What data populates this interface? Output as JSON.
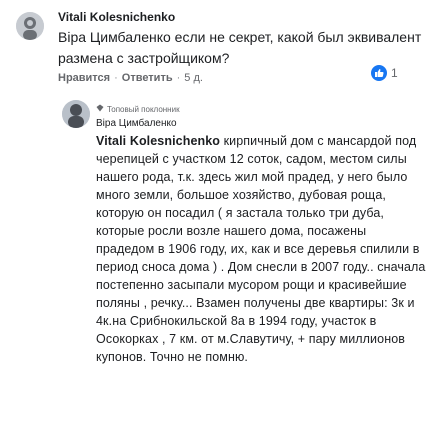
{
  "comment": {
    "author": "Vitali Kolesnichenko",
    "text": "Віра Цимбаленко если не секрет, какой был эквивалент размена с застройщиком?",
    "actions": {
      "like_label": "Нравится",
      "reply_label": "Ответить",
      "time": "5 д."
    },
    "reaction_count": "1"
  },
  "reply": {
    "badge": "Топовый поклонник",
    "author": "Віра Цимбаленко",
    "mention": "Vitali Kolesnichenko",
    "text": " кирпичный дом с мансардой под черепицей с участком 12 соток, садом, местом силы нашего рода, т.к. здесь жил мой прадед, у него было много земли, большое хозяйство, дубовая роща, которую он посадил ( я застала только три дуба, которые росли возле нашего дома, посажены прадедом в 1906 году, их, как и все деревья спилили в период сноса дома ) . Дом снесли в 2007 году.. сначала постепенно засыпали мусором рощи и красивейшие поляны , речку... Взамен получены две квартиры: 3к и 4к.на Срибнокильской 8а в 1994 году, участок в Осокорках , 7 км. от м.Славутичу, + пару миллионов купонов. Точно не помню."
  },
  "colors": {
    "like_blue": "#1877f2",
    "text": "#1c1e21",
    "muted": "#65676b"
  }
}
